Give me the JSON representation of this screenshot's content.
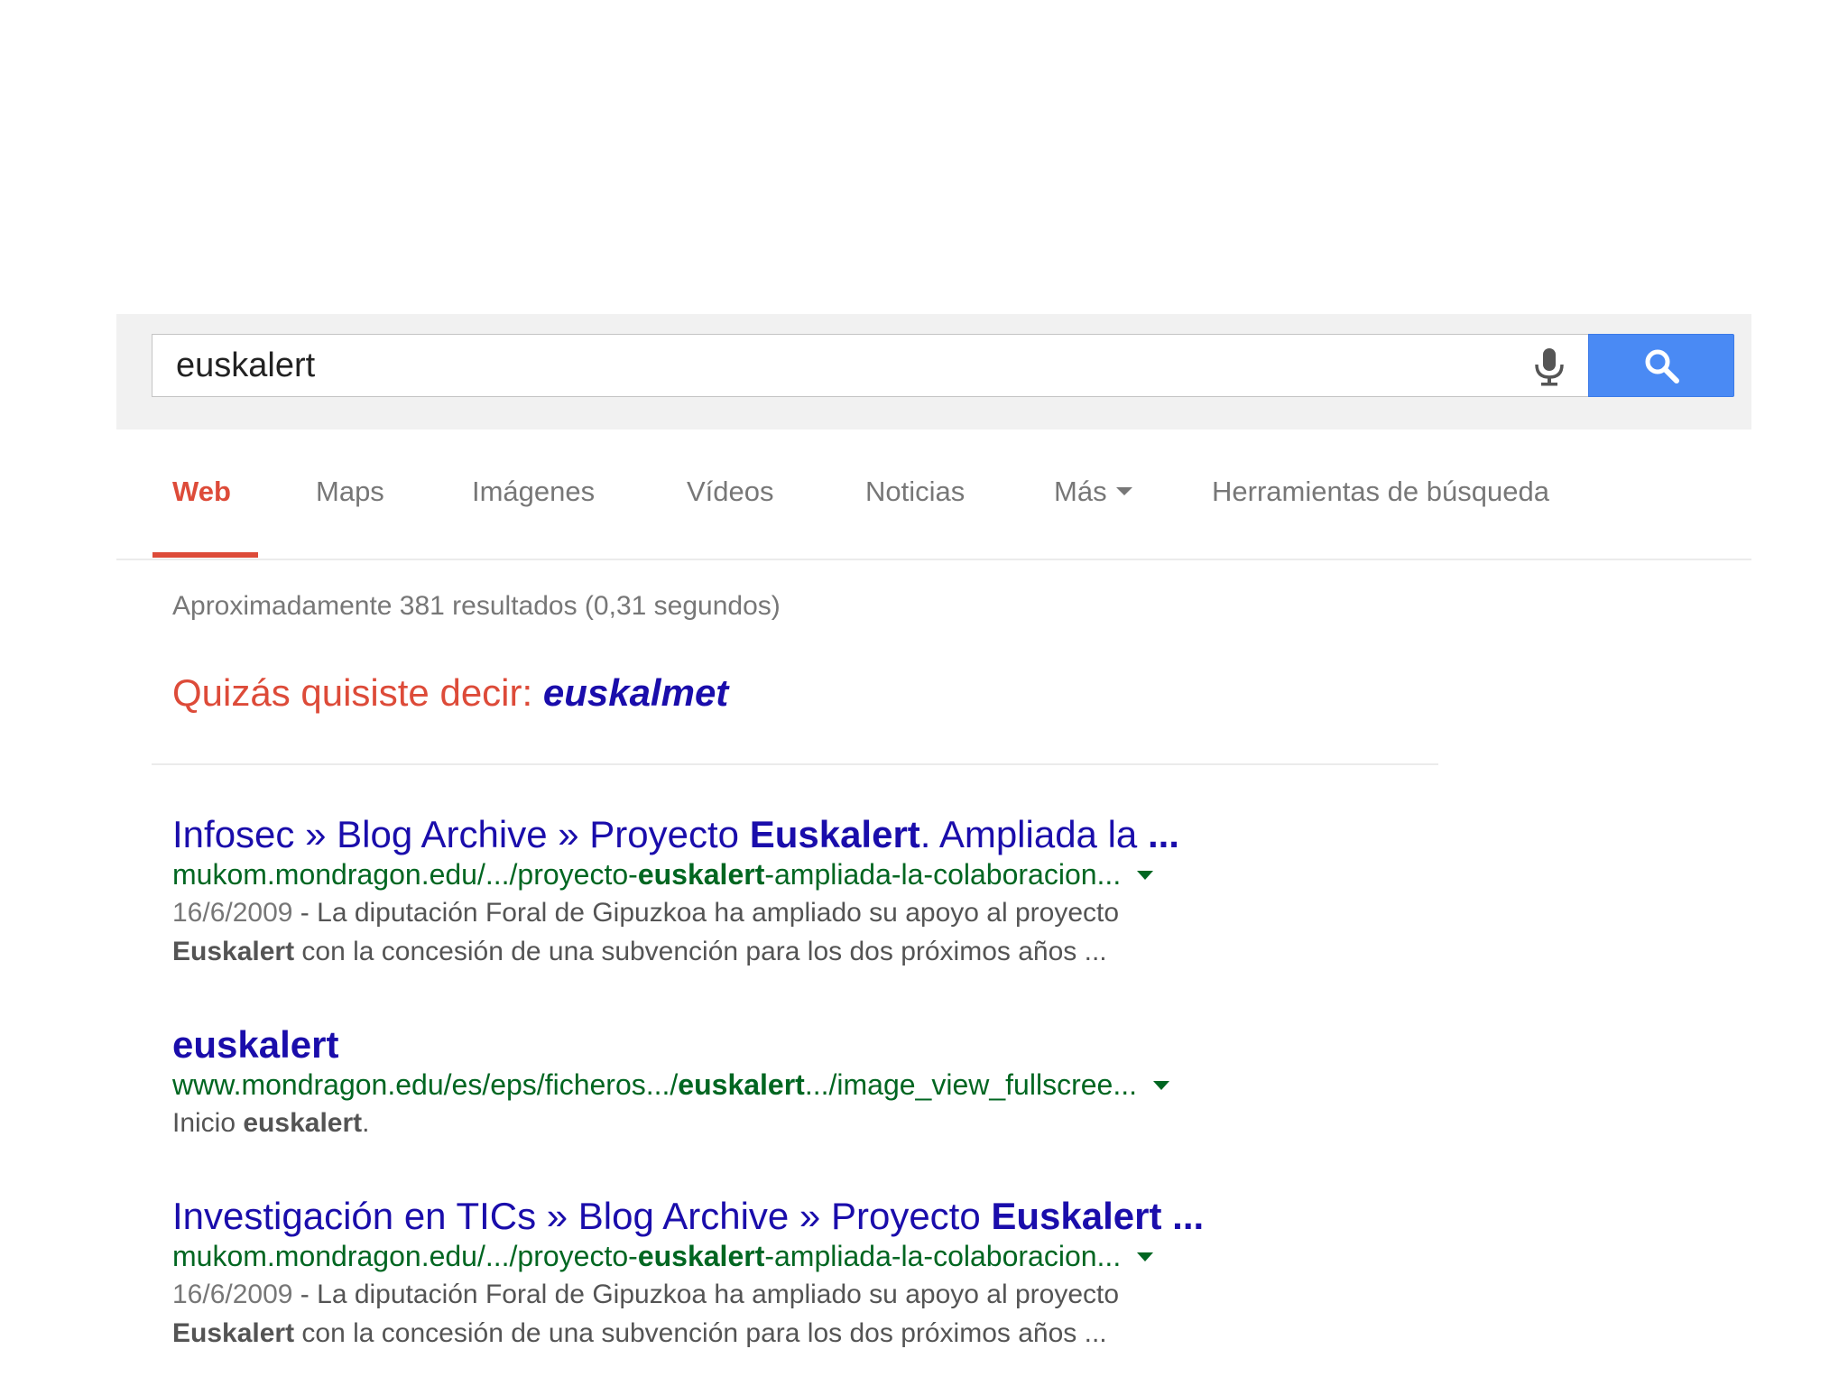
{
  "search": {
    "query": "euskalert",
    "mic_icon": "microphone-icon",
    "button_icon": "magnifier-icon"
  },
  "tabs": [
    {
      "label": "Web",
      "active": true
    },
    {
      "label": "Maps",
      "active": false
    },
    {
      "label": "Imágenes",
      "active": false
    },
    {
      "label": "Vídeos",
      "active": false
    },
    {
      "label": "Noticias",
      "active": false
    },
    {
      "label": "Más",
      "active": false,
      "has_dropdown": true
    },
    {
      "label": "Herramientas de búsqueda",
      "active": false
    }
  ],
  "stats": "Aproximadamente 381 resultados (0,31 segundos)",
  "suggestion": {
    "prefix": "Quizás quisiste decir: ",
    "term": "euskalmet"
  },
  "results": [
    {
      "title_prefix": "Infosec » Blog Archive » Proyecto ",
      "title_bold": "Euskalert",
      "title_suffix": ". Ampliada la ",
      "title_ellipsis": "...",
      "url_prefix": "mukom.mondragon.edu/.../proyecto-",
      "url_bold": "euskalert",
      "url_suffix": "-ampliada-la-colaboracion...",
      "date": "16/6/2009",
      "snippet_line1": " - La diputación Foral de Gipuzkoa ha ampliado su apoyo al proyecto",
      "snippet_bold": "Euskalert",
      "snippet_line2": " con la concesión de una subvención para los dos próximos años ..."
    },
    {
      "title_bold": "euskalert",
      "url_prefix": "www.mondragon.edu/es/eps/ficheros.../",
      "url_bold": "euskalert",
      "url_suffix": ".../image_view_fullscree...",
      "snippet_prefix": "Inicio ",
      "snippet_bold": "euskalert",
      "snippet_suffix": "."
    },
    {
      "title_prefix": "Investigación en TICs » Blog Archive » Proyecto ",
      "title_bold": "Euskalert",
      "title_ellipsis": " ...",
      "url_prefix": "mukom.mondragon.edu/.../proyecto-",
      "url_bold": "euskalert",
      "url_suffix": "-ampliada-la-colaboracion...",
      "date": "16/6/2009",
      "snippet_line1": " - La diputación Foral de Gipuzkoa ha ampliado su apoyo al proyecto",
      "snippet_bold": "Euskalert",
      "snippet_line2": " con la concesión de una subvención para los dos próximos años ..."
    }
  ],
  "colors": {
    "accent_red": "#dd4b39",
    "link_blue": "#1a0dab",
    "url_green": "#006621",
    "button_blue": "#4a8af4"
  }
}
